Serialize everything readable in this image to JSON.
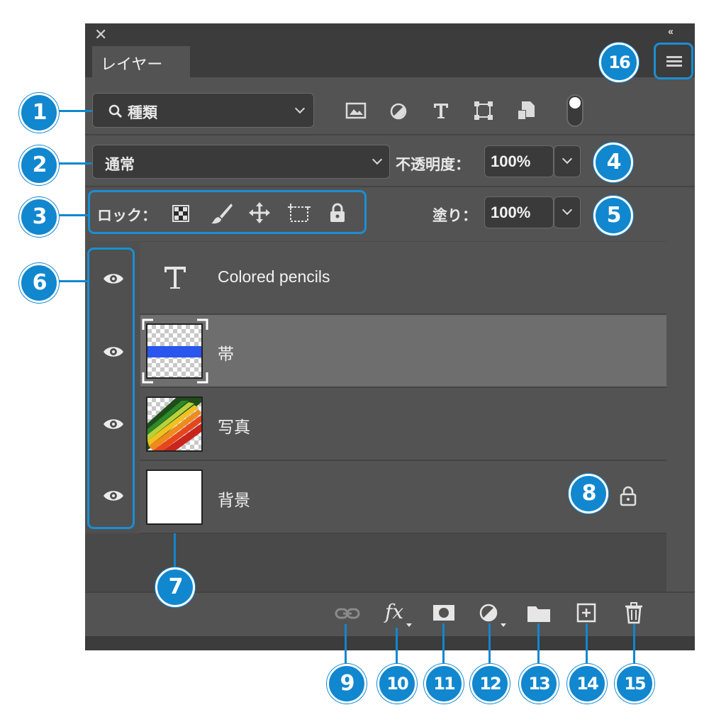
{
  "window": {
    "close": "✕",
    "collapse": "‹‹"
  },
  "tabs": [
    {
      "label": "レイヤー"
    }
  ],
  "filter": {
    "label": "種類",
    "icons": [
      "image-filter-icon",
      "adjustment-filter-icon",
      "type-filter-icon",
      "shape-filter-icon",
      "smart-object-filter-icon",
      "filter-toggle-icon"
    ]
  },
  "blend": {
    "mode": "通常",
    "opacity_label": "不透明度：",
    "opacity_value": "100%"
  },
  "lock": {
    "label": "ロック：",
    "icons": [
      "lock-transparent-icon",
      "lock-image-icon",
      "lock-position-icon",
      "lock-artboard-icon",
      "lock-all-icon"
    ],
    "fill_label": "塗り：",
    "fill_value": "100%"
  },
  "layers": [
    {
      "name": "Colored pencils",
      "type": "text",
      "visible": true,
      "selected": false,
      "locked": false
    },
    {
      "name": "帯",
      "type": "raster",
      "visible": true,
      "selected": true,
      "locked": false
    },
    {
      "name": "写真",
      "type": "image",
      "visible": true,
      "selected": false,
      "locked": false
    },
    {
      "name": "背景",
      "type": "background",
      "visible": true,
      "selected": false,
      "locked": true
    }
  ],
  "bottom_icons": [
    "link-icon",
    "fx-icon",
    "mask-icon",
    "adjustment-icon",
    "folder-icon",
    "new-layer-icon",
    "trash-icon"
  ],
  "bottom_fx": "fx",
  "callouts": [
    "1",
    "2",
    "3",
    "4",
    "5",
    "6",
    "7",
    "8",
    "9",
    "10",
    "11",
    "12",
    "13",
    "14",
    "15",
    "16"
  ],
  "colors": {
    "panel": "#535353",
    "dark": "#3c3c3c",
    "accent": "#1187cf",
    "selected_row": "#6e6e6e",
    "band": "#2a55ee"
  }
}
